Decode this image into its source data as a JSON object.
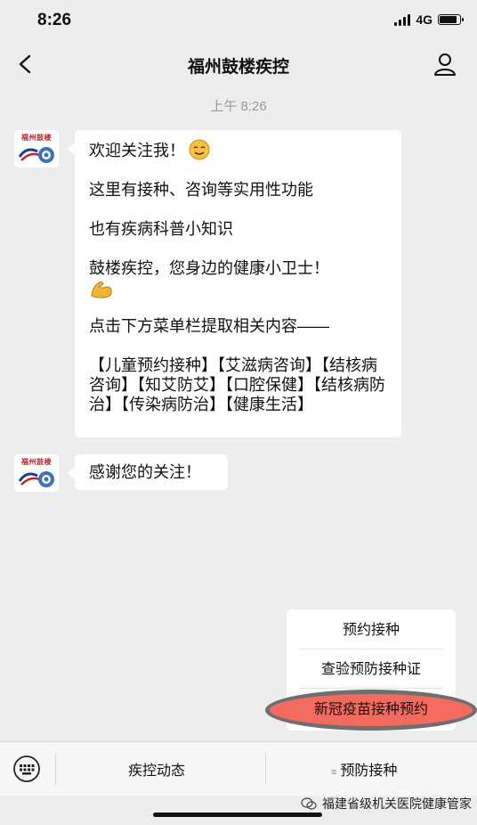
{
  "status_bar": {
    "time": "8:26",
    "network": "4G",
    "battery_level": 0.85
  },
  "nav": {
    "title": "福州鼓楼疾控"
  },
  "timestamp": "上午 8:26",
  "avatar": {
    "text": "福州鼓楼"
  },
  "messages": [
    {
      "lines": [
        "欢迎关注我！",
        "这里有接种、咨询等实用性功能",
        "也有疾病科普小知识",
        "鼓楼疾控，您身边的健康小卫士！",
        "点击下方菜单栏提取相关内容——",
        "【儿童预约接种】【艾滋病咨询】【结核病咨询】【知艾防艾】【口腔保健】【结核病防治】【传染病防治】【健康生活】"
      ]
    },
    {
      "lines": [
        "感谢您的关注！"
      ]
    }
  ],
  "menu_popup": {
    "items": [
      "预约接种",
      "查验预防接种证",
      "新冠疫苗接种预约"
    ],
    "highlight_color": "#f26b5e"
  },
  "bottom_bar": {
    "items": [
      "疾控动态",
      "预防接种"
    ]
  },
  "watermark": "福建省级机关医院健康管家"
}
